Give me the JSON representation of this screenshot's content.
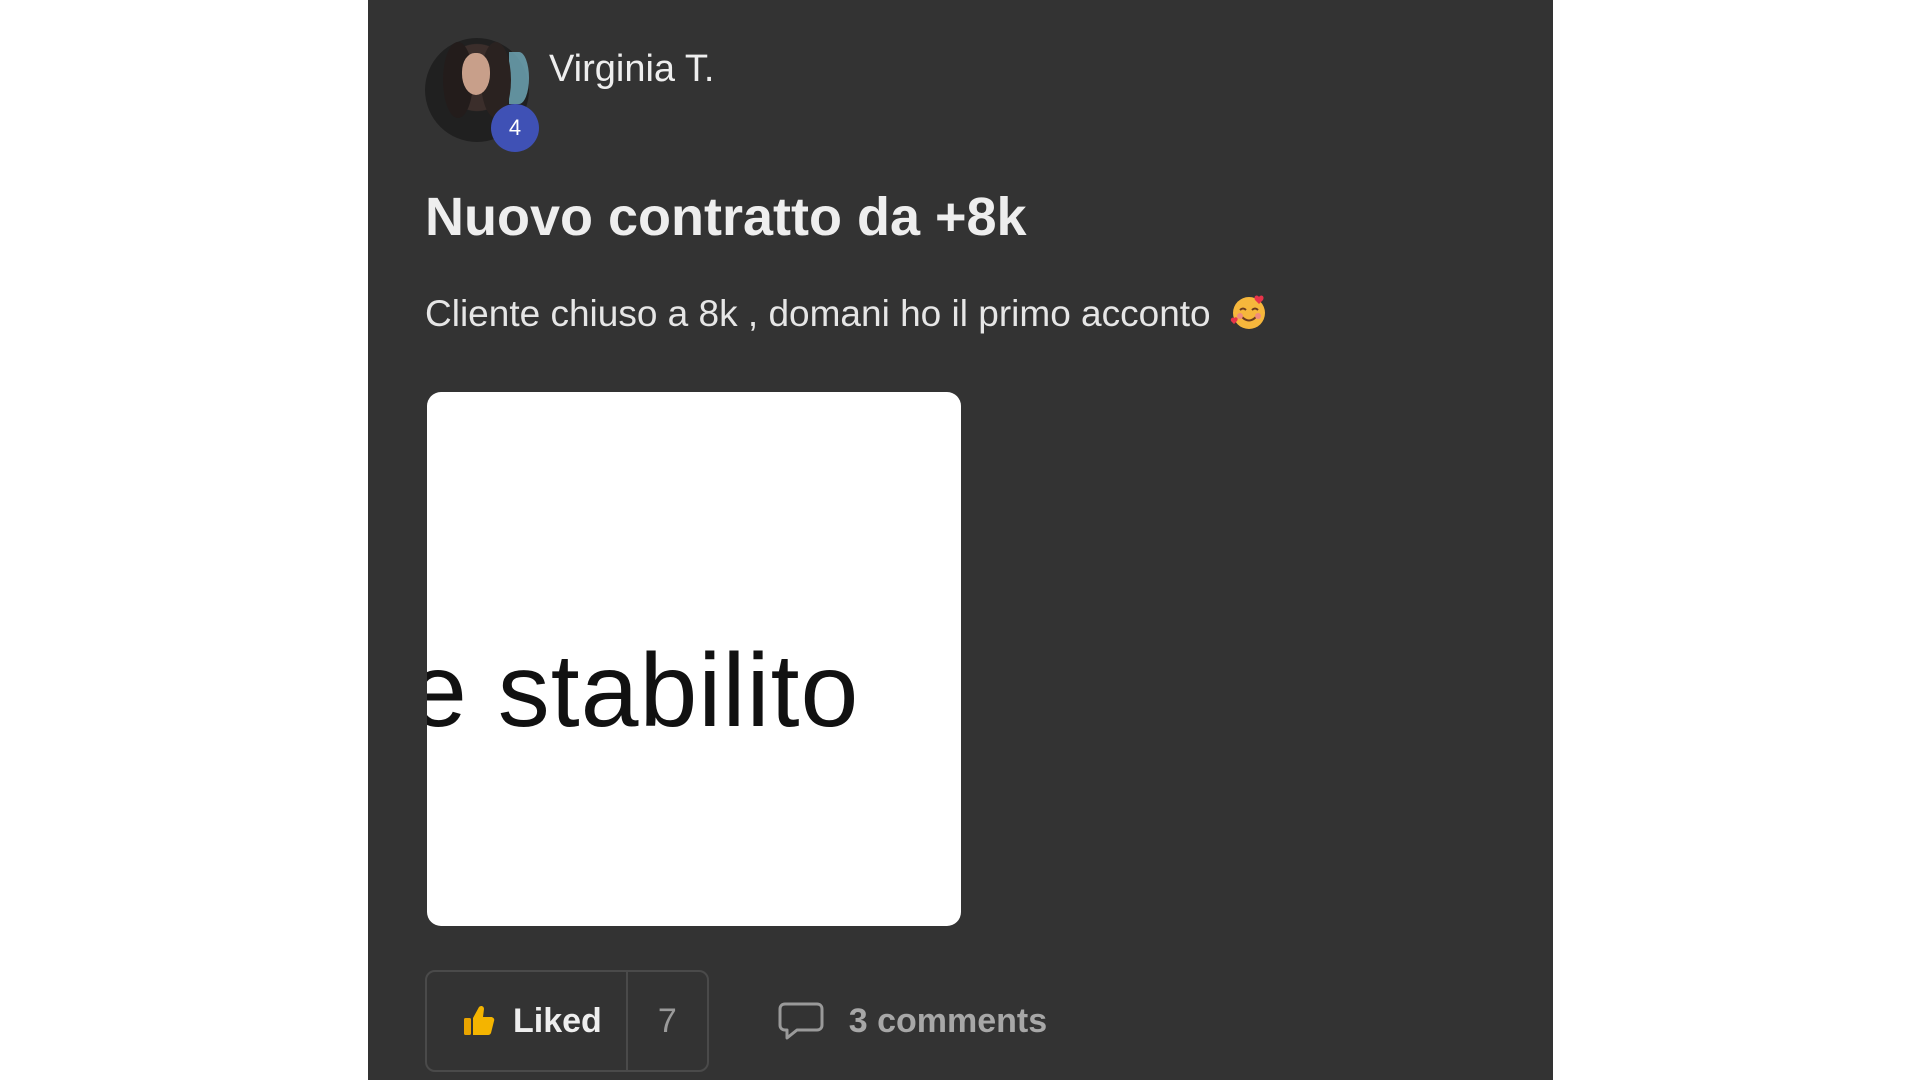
{
  "post": {
    "author": {
      "name": "Virginia T.",
      "level": "4"
    },
    "title": "Nuovo contratto da +8k",
    "body": "Cliente chiuso a 8k , domani ho il primo acconto",
    "body_emoji": "smiling-face-with-hearts-icon",
    "attachment": {
      "text": "e  stabilito"
    },
    "actions": {
      "like_label": "Liked",
      "like_count": "7",
      "comments_label": "3 comments"
    }
  },
  "colors": {
    "page_background": "#ffffff",
    "card_background": "#333333",
    "level_badge": "#3f51b5",
    "text_primary": "#eeeeee",
    "text_muted": "#a7a7a7",
    "like_icon": "#f4b400"
  }
}
